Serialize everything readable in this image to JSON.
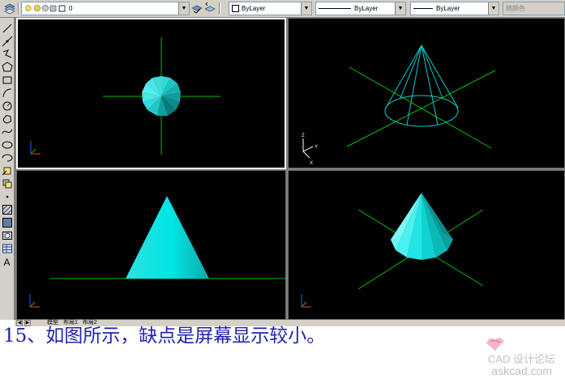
{
  "toolbar": {
    "layer_value": "0",
    "color_value": "ByLayer",
    "linetype_value": "ByLayer",
    "lineweight_value": "ByLayer",
    "plotstyle_value": "随颜色",
    "dropdown_arrow": "▼"
  },
  "layout_tabs": [
    "模型",
    "布局1",
    "布局2"
  ],
  "tab_nav": [
    "◀",
    "▶"
  ],
  "caption": "15、如图所示，缺点是屏幕显示较小。",
  "watermark": {
    "title": "CAD 设计论坛",
    "site": "askcad.com"
  },
  "ucs_labels": {
    "x": "X",
    "y": "Y",
    "z": "Z"
  },
  "colors": {
    "viewport_bg": "#000000",
    "solid": "#00e5e5",
    "axis_line": "#00c000",
    "toolbar_bg": "#d4d0c8",
    "caption": "#2222b0"
  }
}
